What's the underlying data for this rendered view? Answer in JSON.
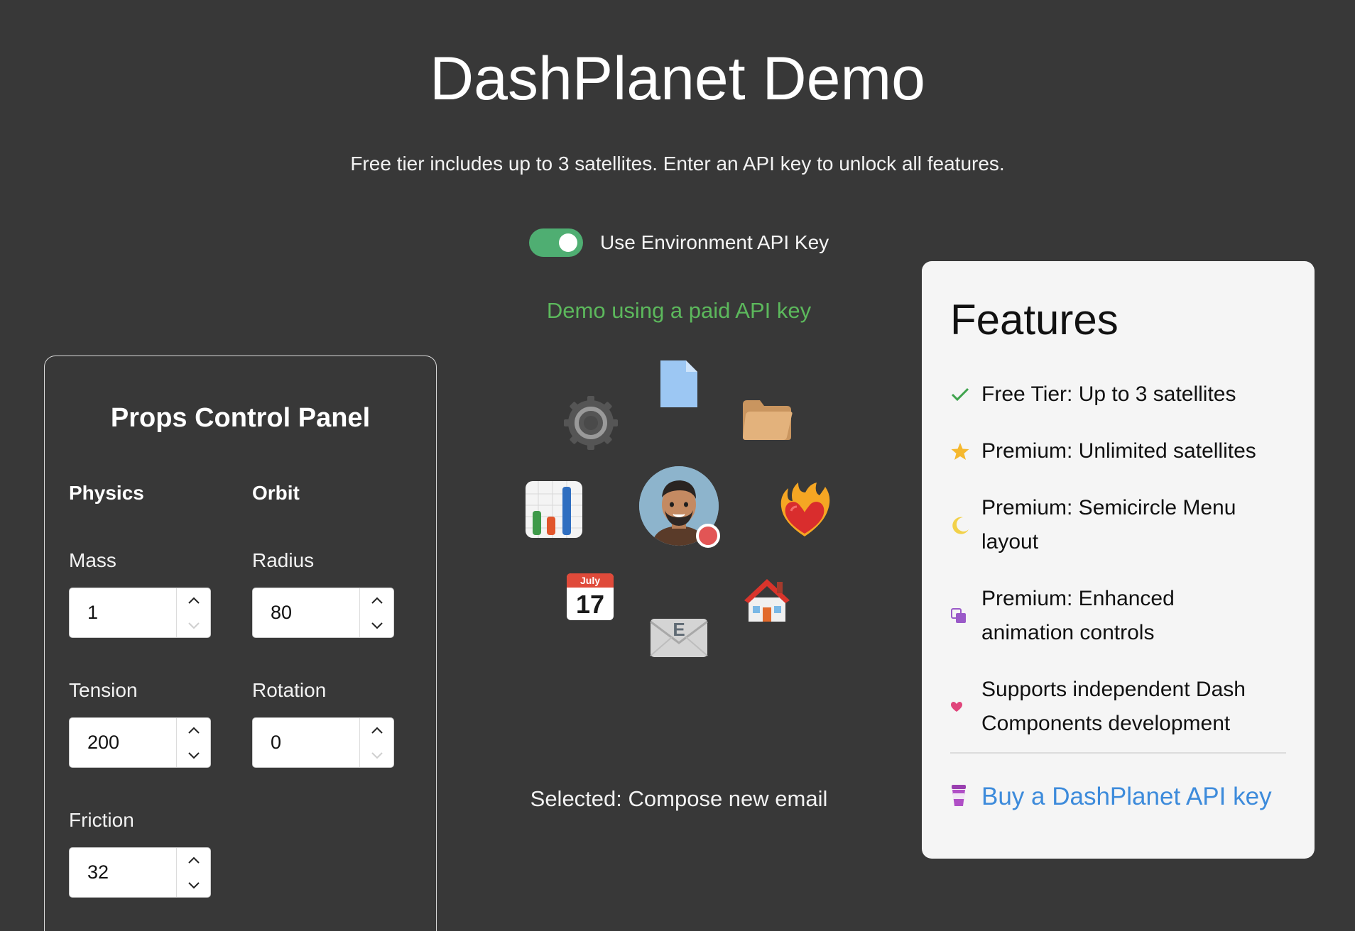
{
  "header": {
    "title": "DashPlanet Demo",
    "subtitle": "Free tier includes up to 3 satellites. Enter an API key to unlock all features."
  },
  "api_toggle": {
    "label": "Use Environment API Key",
    "state": "on",
    "color": "#4fae72"
  },
  "status_message": "Demo using a paid API key",
  "control_panel": {
    "title": "Props Control Panel",
    "physics": {
      "heading": "Physics",
      "mass": {
        "label": "Mass",
        "value": "1"
      },
      "tension": {
        "label": "Tension",
        "value": "200"
      },
      "friction": {
        "label": "Friction",
        "value": "32"
      }
    },
    "orbit": {
      "heading": "Orbit",
      "radius": {
        "label": "Radius",
        "value": "80"
      },
      "rotation": {
        "label": "Rotation",
        "value": "0"
      }
    }
  },
  "planet_menu": {
    "center": "avatar-with-status",
    "satellites": [
      "document-icon",
      "folder-icon",
      "heart-on-fire-icon",
      "house-icon",
      "email-icon",
      "calendar-icon",
      "bar-chart-icon",
      "gear-icon"
    ],
    "calendar": {
      "month": "July",
      "day": "17"
    },
    "email_letter": "E",
    "selected_text": "Selected: Compose new email"
  },
  "features": {
    "title": "Features",
    "items": [
      {
        "icon": "check-icon",
        "text": "Free Tier: Up to 3 satellites"
      },
      {
        "icon": "star-icon",
        "text": "Premium: Unlimited satellites"
      },
      {
        "icon": "moon-icon",
        "text_line1": "Premium: Semicircle Menu",
        "text_line2": "layout"
      },
      {
        "icon": "copy-icon",
        "text_line1": "Premium: Enhanced",
        "text_line2": "animation controls"
      },
      {
        "icon": "heart-icon",
        "text_line1": "Supports independent Dash",
        "text_line2": "Components development"
      }
    ],
    "buy_link": "Buy a DashPlanet API key"
  }
}
